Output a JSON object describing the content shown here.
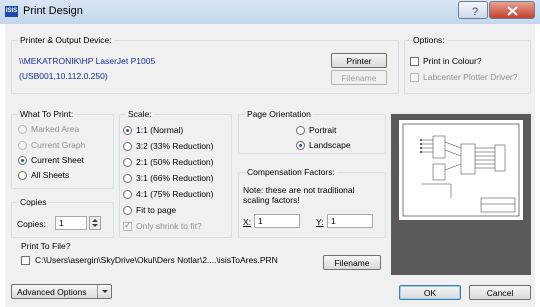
{
  "window": {
    "title": "Print Design",
    "app_icon_text": "ISIS",
    "help_button": "?",
    "close_button": "×"
  },
  "printer": {
    "legend": "Printer & Output Device:",
    "device_name": "\\\\MEKATRONIK\\HP LaserJet P1005",
    "device_port": "(USB001,10.112.0.250)",
    "printer_button": "Printer",
    "filename_button": "Filename"
  },
  "options": {
    "legend": "Options:",
    "print_in_colour": "Print in Colour?",
    "labcenter_plotter": "Labcenter Plotter Driver?"
  },
  "what_to_print": {
    "legend": "What To Print:",
    "items": [
      "Marked Area",
      "Current Graph",
      "Current Sheet",
      "All Sheets"
    ],
    "selected": "Current Sheet"
  },
  "copies": {
    "legend": "Copies",
    "label": "Copies:",
    "value": "1"
  },
  "scale": {
    "legend": "Scale:",
    "items": [
      "1:1 (Normal)",
      "3:2 (33% Reduction)",
      "2:1 (50% Reduction)",
      "3:1 (66% Reduction)",
      "4:1 (75% Reduction)",
      "Fit to page"
    ],
    "selected": "1:1 (Normal)",
    "only_shrink": "Only shrink to fit?"
  },
  "orientation": {
    "legend": "Page Orientation",
    "portrait": "Portrait",
    "landscape": "Landscape",
    "selected": "Landscape"
  },
  "compensation": {
    "legend": "Compensation Factors:",
    "note_line1": "Note: these are not traditional",
    "note_line2": "scaling factors!",
    "x_label": "X:",
    "x_value": "1",
    "y_label": "Y:",
    "y_value": "1"
  },
  "print_to_file": {
    "legend": "Print To File?",
    "path": "C:\\Users\\asergin\\SkyDrive\\Okul\\Ders Notlar\\2....\\isisToAres.PRN",
    "filename_button": "Filename"
  },
  "footer": {
    "advanced_options": "Advanced Options",
    "ok": "OK",
    "cancel": "Cancel"
  }
}
